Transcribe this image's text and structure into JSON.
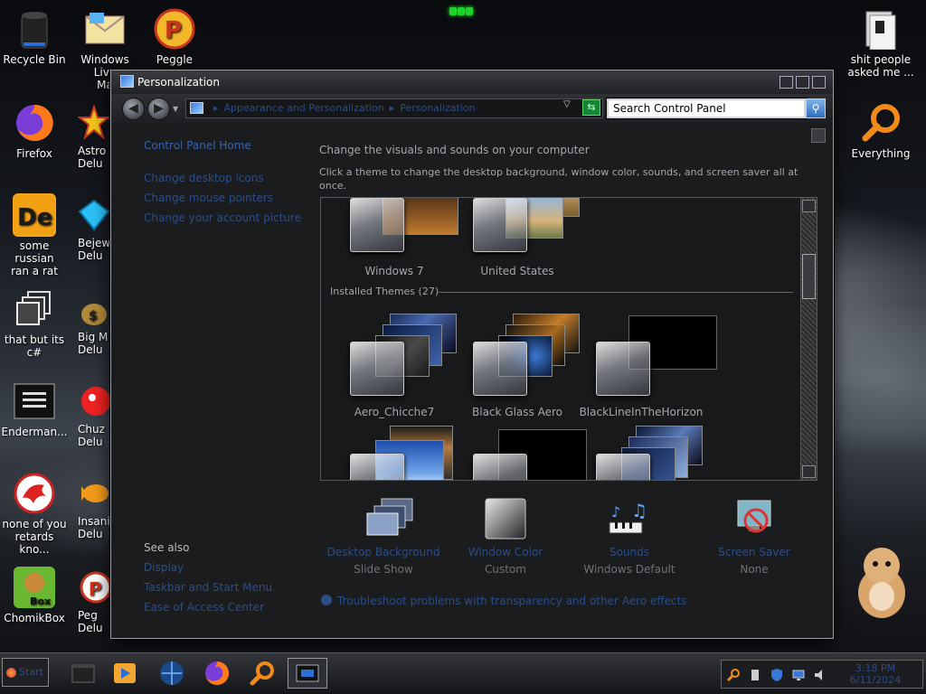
{
  "desktop": {
    "icons_left": [
      {
        "label": "Recycle Bin"
      },
      {
        "label": "Firefox"
      },
      {
        "label": "some russian\nran a rat"
      },
      {
        "label": "that but its\nc#"
      },
      {
        "label": "Enderman..."
      },
      {
        "label": "none of you\nretards kno..."
      },
      {
        "label": "ChomikBox"
      }
    ],
    "icons_col2": [
      {
        "label": "Windows Live\nMa"
      },
      {
        "label": "Astro\nDelu"
      },
      {
        "label": "Bejew\nDelu"
      },
      {
        "label": "Big M\nDelu"
      },
      {
        "label": "Chuz\nDelu"
      },
      {
        "label": "Insaniq\nDelu"
      },
      {
        "label": "Peg\nDelu"
      }
    ],
    "icon_peggle": {
      "label": "Peggle"
    },
    "icons_right": [
      {
        "label": "shit people\nasked me ..."
      },
      {
        "label": "Everything"
      }
    ]
  },
  "window": {
    "title": "Personalization",
    "address": {
      "crumb1": "Appearance and Personalization",
      "crumb2": "Personalization"
    },
    "search": {
      "value": "Search Control Panel"
    },
    "left_links": [
      "Control Panel Home",
      "Change desktop icons",
      "Change mouse pointers",
      "Change your account picture"
    ],
    "see_also": {
      "heading": "See also",
      "links": [
        "Display",
        "Taskbar and Start Menu",
        "Ease of Access Center"
      ]
    },
    "heading": "Change the visuals and sounds on your computer",
    "description": "Click a theme to change the desktop background, window color, sounds, and screen saver all at once.",
    "themes_top": [
      {
        "name": "Windows 7"
      },
      {
        "name": "United States"
      }
    ],
    "installed_label": "Installed Themes (27)",
    "themes_installed": [
      {
        "name": "Aero_Chicche7"
      },
      {
        "name": "Black Glass Aero"
      },
      {
        "name": "BlackLineInTheHorizon"
      }
    ],
    "bottom": [
      {
        "title": "Desktop Background",
        "sub": "Slide Show"
      },
      {
        "title": "Window Color",
        "sub": "Custom"
      },
      {
        "title": "Sounds",
        "sub": "Windows Default"
      },
      {
        "title": "Screen Saver",
        "sub": "None"
      }
    ],
    "troubleshoot": "Troubleshoot problems with transparency and other Aero effects"
  },
  "taskbar": {
    "start_label": "Start",
    "clock_time": "3:18 PM",
    "clock_date": "6/11/2024"
  }
}
